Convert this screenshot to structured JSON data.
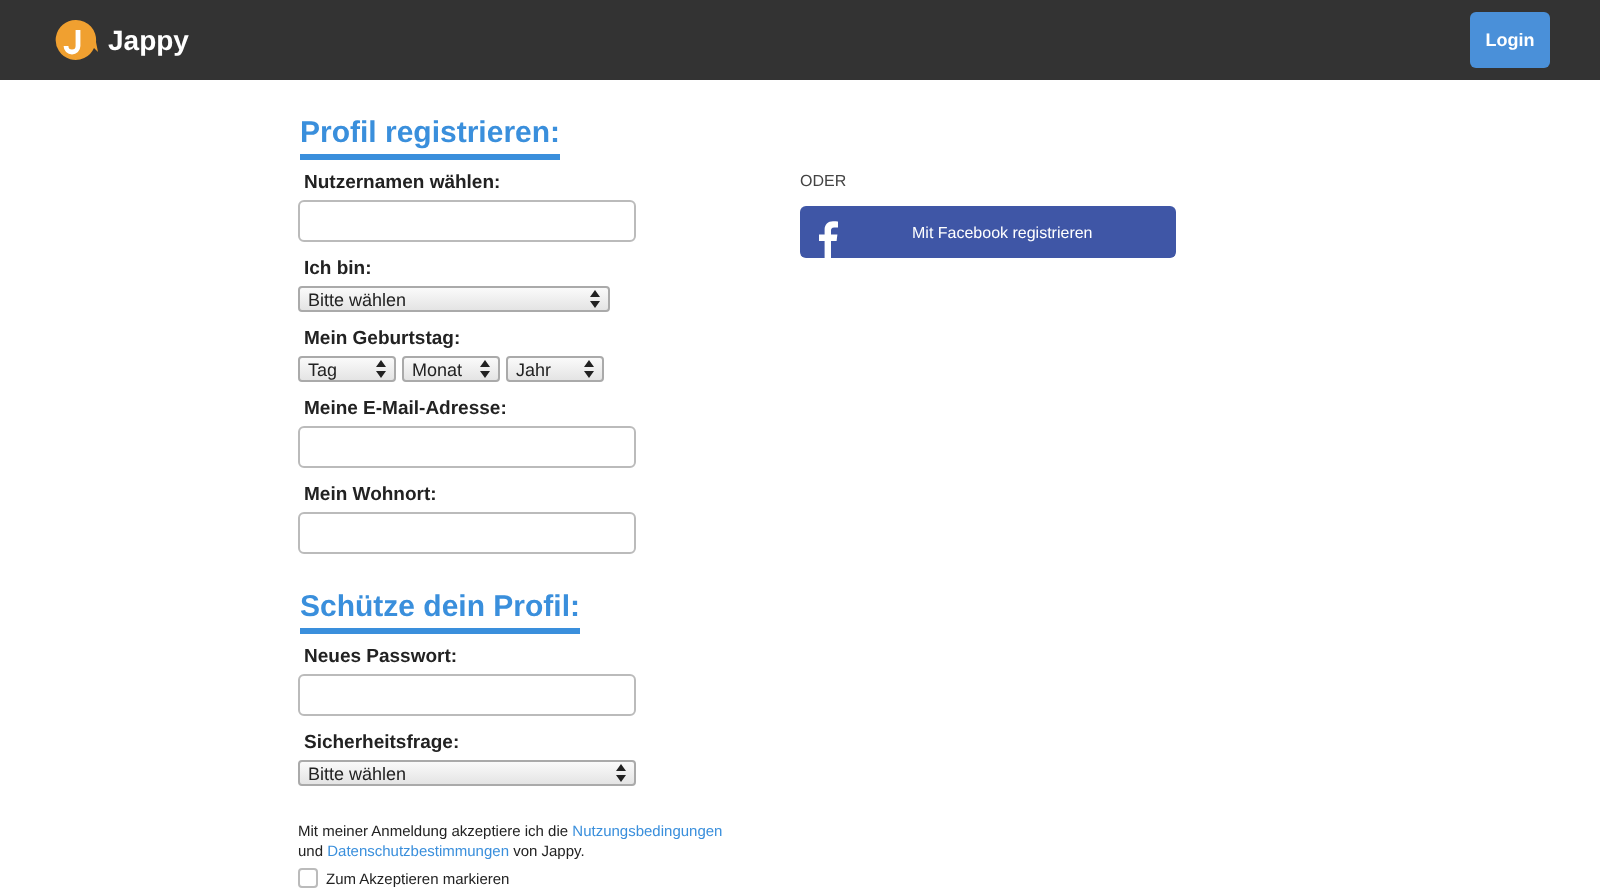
{
  "header": {
    "brand": "Jappy",
    "login_button": "Login"
  },
  "sections": [
    {
      "title": "Profil registrieren:",
      "fields": [
        {
          "kind": "input",
          "label": "Nutzernamen wählen:"
        },
        {
          "kind": "select",
          "label": "Ich bin:",
          "selects": [
            "Bitte wählen"
          ]
        },
        {
          "kind": "selects",
          "label": "Mein Geburtstag:",
          "selects": [
            "Tag",
            "Monat",
            "Jahr"
          ]
        },
        {
          "kind": "input",
          "label": "Meine E-Mail-Adresse:"
        },
        {
          "kind": "input",
          "label": "Mein Wohnort:"
        }
      ]
    },
    {
      "title": "Schütze dein Profil:",
      "fields": [
        {
          "kind": "input",
          "label": "Neues Passwort:"
        },
        {
          "kind": "select_wide",
          "label": "Sicherheitsfrage:",
          "selects": [
            "Bitte wählen"
          ]
        }
      ]
    }
  ],
  "terms": {
    "before": "Mit meiner Anmeldung akzeptiere ich die",
    "link1": "Nutzungsbedingungen",
    "middle": "und",
    "link2": "Datenschutzbestimmungen",
    "after": "von Jappy."
  },
  "accept": {
    "label": "Zum Akzeptieren markieren",
    "checked": false
  },
  "alternative": {
    "or_label": "ODER",
    "facebook_button": "Mit Facebook registrieren"
  }
}
